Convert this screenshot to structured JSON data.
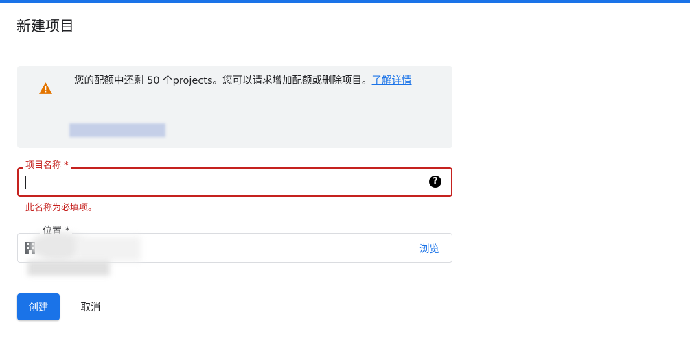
{
  "page": {
    "title": "新建项目"
  },
  "quota": {
    "message": "您的配额中还剩 50 个projects。您可以请求增加配额或删除项目。",
    "learn_more": "了解详情",
    "warning_color": "#e37400"
  },
  "name_field": {
    "label": "项目名称 *",
    "value": "",
    "help_icon": "?",
    "error": "此名称为必填项。",
    "error_color": "#c5221f"
  },
  "location_field": {
    "label": "位置 *",
    "icon": "organization-icon",
    "browse": "浏览"
  },
  "actions": {
    "create": "创建",
    "cancel": "取消"
  },
  "colors": {
    "accent": "#1a73e8"
  }
}
